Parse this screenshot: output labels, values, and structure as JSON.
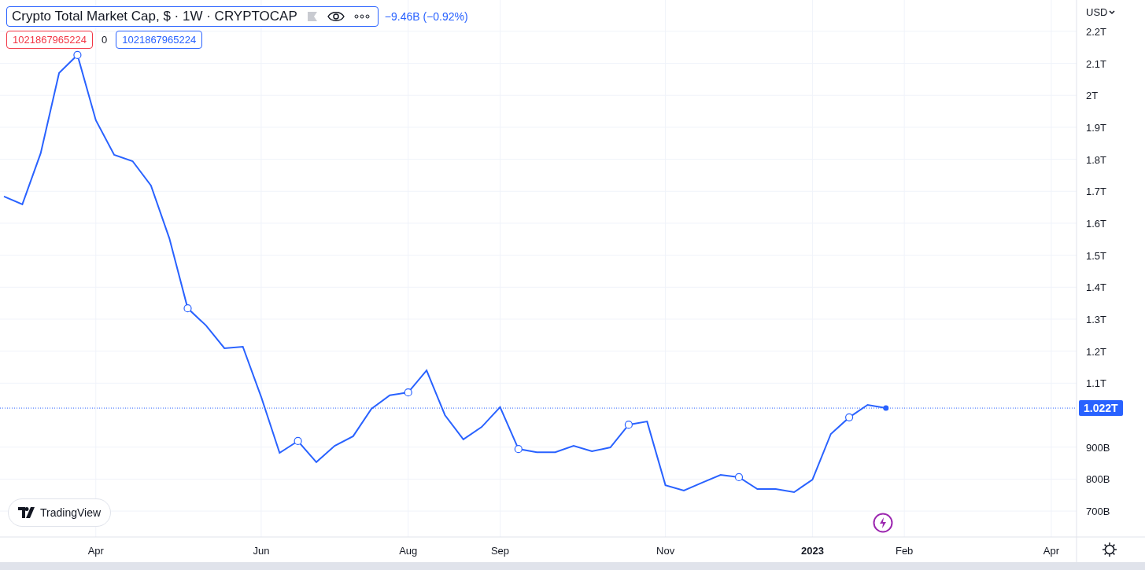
{
  "legend": {
    "title": "Crypto Total Market Cap, $ · 1W · CRYPTOCAP",
    "change": "−9.46B (−0.92%)",
    "inputs": [
      {
        "kind": "box",
        "text": "1021867965224",
        "color": "#f23645"
      },
      {
        "kind": "plain",
        "text": "0"
      },
      {
        "kind": "box",
        "text": "1021867965224",
        "color": "#2962ff"
      }
    ]
  },
  "currency": "USD",
  "logo": "TradingView",
  "chart_data": {
    "type": "line",
    "grid": true,
    "ylim": [
      619000000000,
      2298000000000
    ],
    "ref_lines": [
      {
        "axis": "y",
        "value": 1022000000000,
        "label": "1.022T",
        "color": "#2962ff"
      }
    ],
    "categories": [
      null,
      null,
      null,
      null,
      null,
      "Apr",
      null,
      null,
      null,
      null,
      null,
      null,
      null,
      null,
      "Jun",
      null,
      null,
      null,
      null,
      null,
      null,
      null,
      "Aug",
      null,
      null,
      null,
      null,
      "Sep",
      null,
      null,
      null,
      null,
      null,
      null,
      null,
      null,
      "Nov",
      null,
      null,
      null,
      null,
      null,
      null,
      null,
      "2023",
      null,
      null,
      null,
      null,
      "Feb",
      null,
      null,
      null,
      null,
      null,
      null,
      null,
      "Apr",
      null
    ],
    "yticks": [
      {
        "value": 2200000000000,
        "label": "2.2T"
      },
      {
        "value": 2100000000000,
        "label": "2.1T"
      },
      {
        "value": 2000000000000,
        "label": "2T"
      },
      {
        "value": 1900000000000,
        "label": "1.9T"
      },
      {
        "value": 1800000000000,
        "label": "1.8T"
      },
      {
        "value": 1700000000000,
        "label": "1.7T"
      },
      {
        "value": 1600000000000,
        "label": "1.6T"
      },
      {
        "value": 1500000000000,
        "label": "1.5T"
      },
      {
        "value": 1400000000000,
        "label": "1.4T"
      },
      {
        "value": 1300000000000,
        "label": "1.3T"
      },
      {
        "value": 1200000000000,
        "label": "1.2T"
      },
      {
        "value": 1100000000000,
        "label": "1.1T"
      },
      {
        "value": 900000000000,
        "label": "900B"
      },
      {
        "value": 800000000000,
        "label": "800B"
      },
      {
        "value": 700000000000,
        "label": "700B"
      }
    ],
    "series": [
      {
        "color": "#2962ff",
        "values": [
          1684000000000,
          1659000000000,
          1819000000000,
          2070000000000,
          2126000000000,
          1922000000000,
          1814000000000,
          1794000000000,
          1718000000000,
          1553000000000,
          1334000000000,
          1280000000000,
          1209000000000,
          1214000000000,
          1057000000000,
          882000000000,
          919000000000,
          853000000000,
          904000000000,
          934000000000,
          1020000000000,
          1062000000000,
          1071000000000,
          1140000000000,
          1000000000000,
          924000000000,
          963000000000,
          1025000000000,
          894000000000,
          884000000000,
          884000000000,
          904000000000,
          887000000000,
          899000000000,
          970000000000,
          980000000000,
          781000000000,
          764000000000,
          789000000000,
          813000000000,
          806000000000,
          769000000000,
          769000000000,
          759000000000,
          798000000000,
          941000000000,
          993000000000,
          1032000000000,
          1022000000000,
          null,
          null,
          null,
          null,
          null,
          null,
          null,
          null,
          null,
          null
        ]
      }
    ]
  }
}
